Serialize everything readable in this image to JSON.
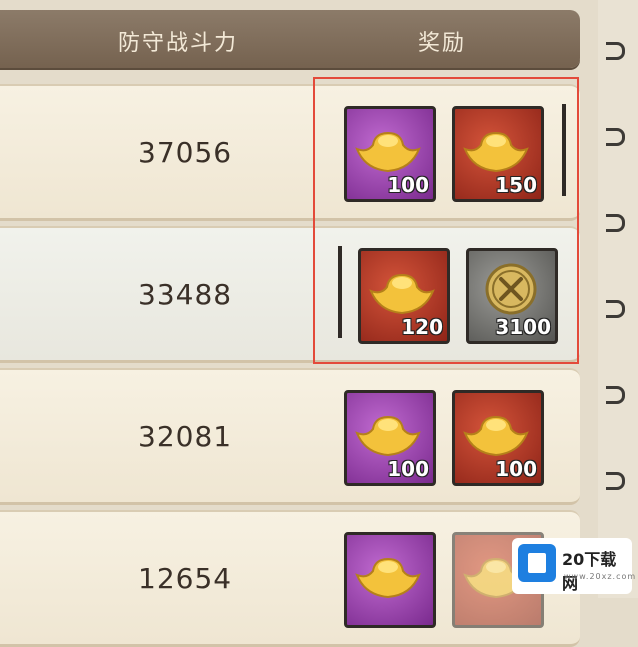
{
  "header": {
    "power_label": "防守战斗力",
    "reward_label": "奖励"
  },
  "rows": [
    {
      "power": "37056",
      "rewards": [
        {
          "icon": "gold-ingot-icon",
          "bg": "purple",
          "qty": "100"
        },
        {
          "icon": "gold-ingot-icon",
          "bg": "red",
          "qty": "150"
        }
      ]
    },
    {
      "power": "33488",
      "rewards": [
        {
          "icon": "gold-ingot-icon",
          "bg": "red",
          "qty": "120"
        },
        {
          "icon": "sword-coin-icon",
          "bg": "grey",
          "qty": "3100"
        }
      ]
    },
    {
      "power": "32081",
      "rewards": [
        {
          "icon": "gold-ingot-icon",
          "bg": "purple",
          "qty": "100"
        },
        {
          "icon": "gold-ingot-icon",
          "bg": "red",
          "qty": "100"
        }
      ]
    },
    {
      "power": "12654",
      "rewards": [
        {
          "icon": "gold-ingot-icon",
          "bg": "purple",
          "qty": ""
        },
        {
          "icon": "gold-ingot-icon",
          "bg": "red",
          "qty": ""
        }
      ]
    }
  ],
  "watermark": {
    "text": "20下载网",
    "sub": "www.20xz.com"
  },
  "colors": {
    "highlight": "#e34a3a",
    "header": "#7d6a57",
    "purple": "#9b3fb0",
    "red": "#b8382a"
  }
}
